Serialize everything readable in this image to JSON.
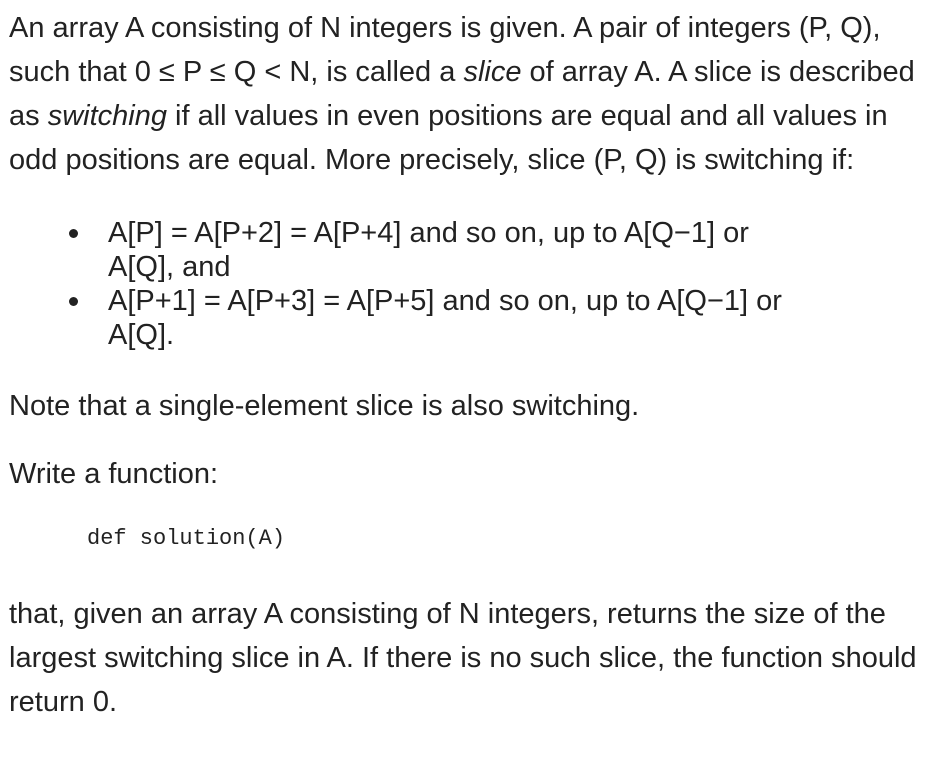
{
  "intro": {
    "part1": "An array A consisting of N integers is given. A pair of integers (P, Q), such that 0 ≤ P ≤ Q < N, is called a ",
    "slice_word": "slice",
    "part2": " of array A. A slice is described as ",
    "switching_word": "switching",
    "part3": " if all values in even positions are equal and all values in odd positions are equal. More precisely, slice (P, Q) is switching if:"
  },
  "conditions": [
    "A[P] = A[P+2] = A[P+4] and so on, up to A[Q−1] or A[Q], and",
    "A[P+1] = A[P+3] = A[P+5] and so on, up to A[Q−1] or A[Q]."
  ],
  "note": "Note that a single-element slice is also switching.",
  "write_prompt": "Write a function:",
  "code_signature": "def solution(A)",
  "description": "that, given an array A consisting of N integers, returns the size of the largest switching slice in A. If there is no such slice, the function should return 0."
}
